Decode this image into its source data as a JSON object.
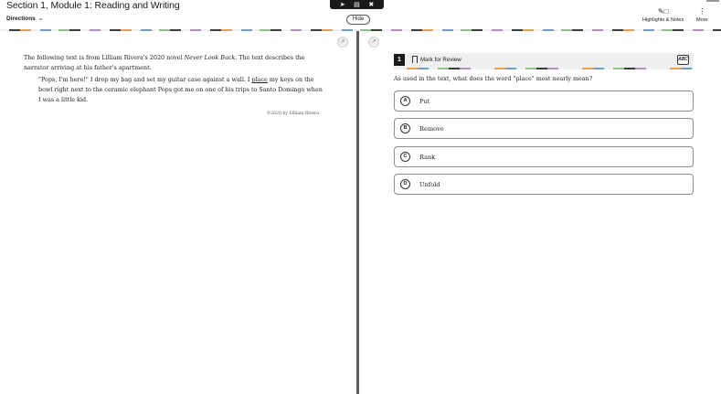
{
  "header": {
    "section_title": "Section 1, Module 1: Reading and Writing",
    "directions_label": "Directions",
    "hide_label": "Hide",
    "highlights_label": "Highlights & Notes",
    "more_label": "More"
  },
  "passage": {
    "intro_before": "The following text is from Lilliam Rivera's 2020 novel ",
    "intro_title": "Never Look Back",
    "intro_after": ". The text describes the narrator arriving at his father's apartment.",
    "quote_part1": "\"Pops, I'm here!\" I drop my bag and set my guitar case against a wall. I ",
    "quote_place": "place",
    "quote_part2": " my keys on the bowl right next to the ceramic elephant Pops got me on one of his trips to Santo Domingo when I was a little kid.",
    "credit": "©2020 by Lilliam Rivera"
  },
  "question": {
    "number": "1",
    "mark_for_review": "Mark for Review",
    "abc_label": "ABC",
    "prompt": "As used in the text, what does the word \"place\" most nearly mean?",
    "choices": [
      {
        "letter": "A",
        "text": "Put"
      },
      {
        "letter": "B",
        "text": "Remove"
      },
      {
        "letter": "C",
        "text": "Rank"
      },
      {
        "letter": "D",
        "text": "Unfold"
      }
    ]
  }
}
